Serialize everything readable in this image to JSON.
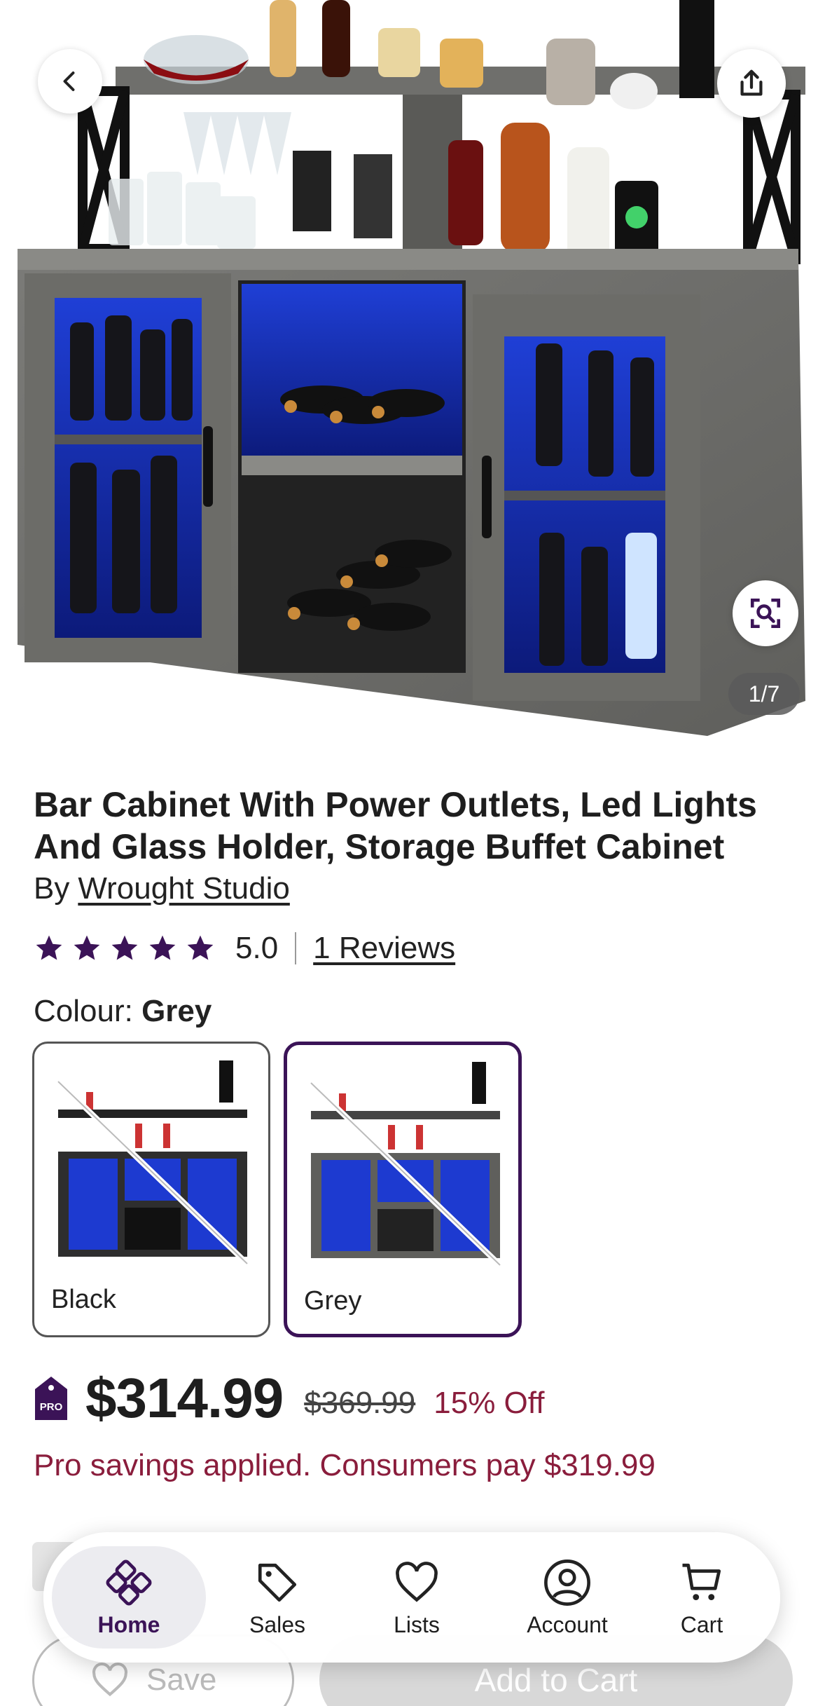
{
  "hero": {
    "image_counter": "1/7"
  },
  "product": {
    "title": "Bar Cabinet With Power Outlets, Led Lights And Glass Holder, Storage Buffet Cabinet",
    "by_prefix": "By",
    "brand": "Wrought Studio",
    "rating_value": "5.0",
    "stars": 5,
    "reviews_link": "1 Reviews"
  },
  "colour": {
    "label": "Colour:",
    "selected": "Grey",
    "options": [
      {
        "name": "Black",
        "selected": false
      },
      {
        "name": "Grey",
        "selected": true
      }
    ]
  },
  "pricing": {
    "badge_text": "PRO",
    "price": "$314.99",
    "original_price": "$369.99",
    "discount": "15% Off",
    "pro_note": "Pro savings applied. Consumers pay $319.99"
  },
  "actions": {
    "save_label": "Save",
    "add_to_cart_label": "Add to Cart"
  },
  "tabbar": {
    "items": [
      {
        "label": "Home",
        "icon": "home-grid-icon",
        "active": true
      },
      {
        "label": "Sales",
        "icon": "tag-icon",
        "active": false
      },
      {
        "label": "Lists",
        "icon": "heart-icon",
        "active": false
      },
      {
        "label": "Account",
        "icon": "account-icon",
        "active": false
      },
      {
        "label": "Cart",
        "icon": "cart-icon",
        "active": false
      }
    ]
  },
  "colors": {
    "brand_purple": "#3b1357",
    "sale_red": "#8a1d3c",
    "star_purple": "#3b1357"
  }
}
